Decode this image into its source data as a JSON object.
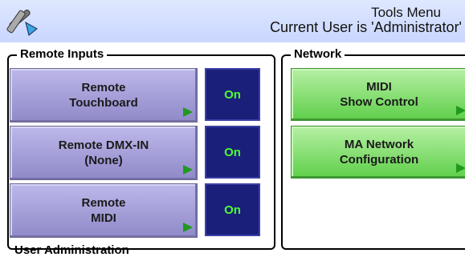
{
  "header": {
    "title": "Tools Menu",
    "user_status": "Current User is 'Administrator'",
    "icon": "tools-icon"
  },
  "remote_inputs": {
    "title": "Remote Inputs",
    "items": [
      {
        "label": "Remote\nTouchboard",
        "state": "On"
      },
      {
        "label": "Remote DMX-IN\n(None)",
        "state": "On"
      },
      {
        "label": "Remote\nMIDI",
        "state": "On"
      }
    ]
  },
  "network": {
    "title": "Network",
    "items": [
      {
        "label": "MIDI\nShow Control"
      },
      {
        "label": "MA Network\nConfiguration"
      }
    ]
  },
  "footer": {
    "next_group_title": "User Administration"
  },
  "colors": {
    "header_bg": "#c9d6ff",
    "purple_button": "#a7a2dc",
    "green_button": "#7fdd68",
    "toggle_bg": "#1a1f7a",
    "toggle_text": "#4cff2f"
  }
}
